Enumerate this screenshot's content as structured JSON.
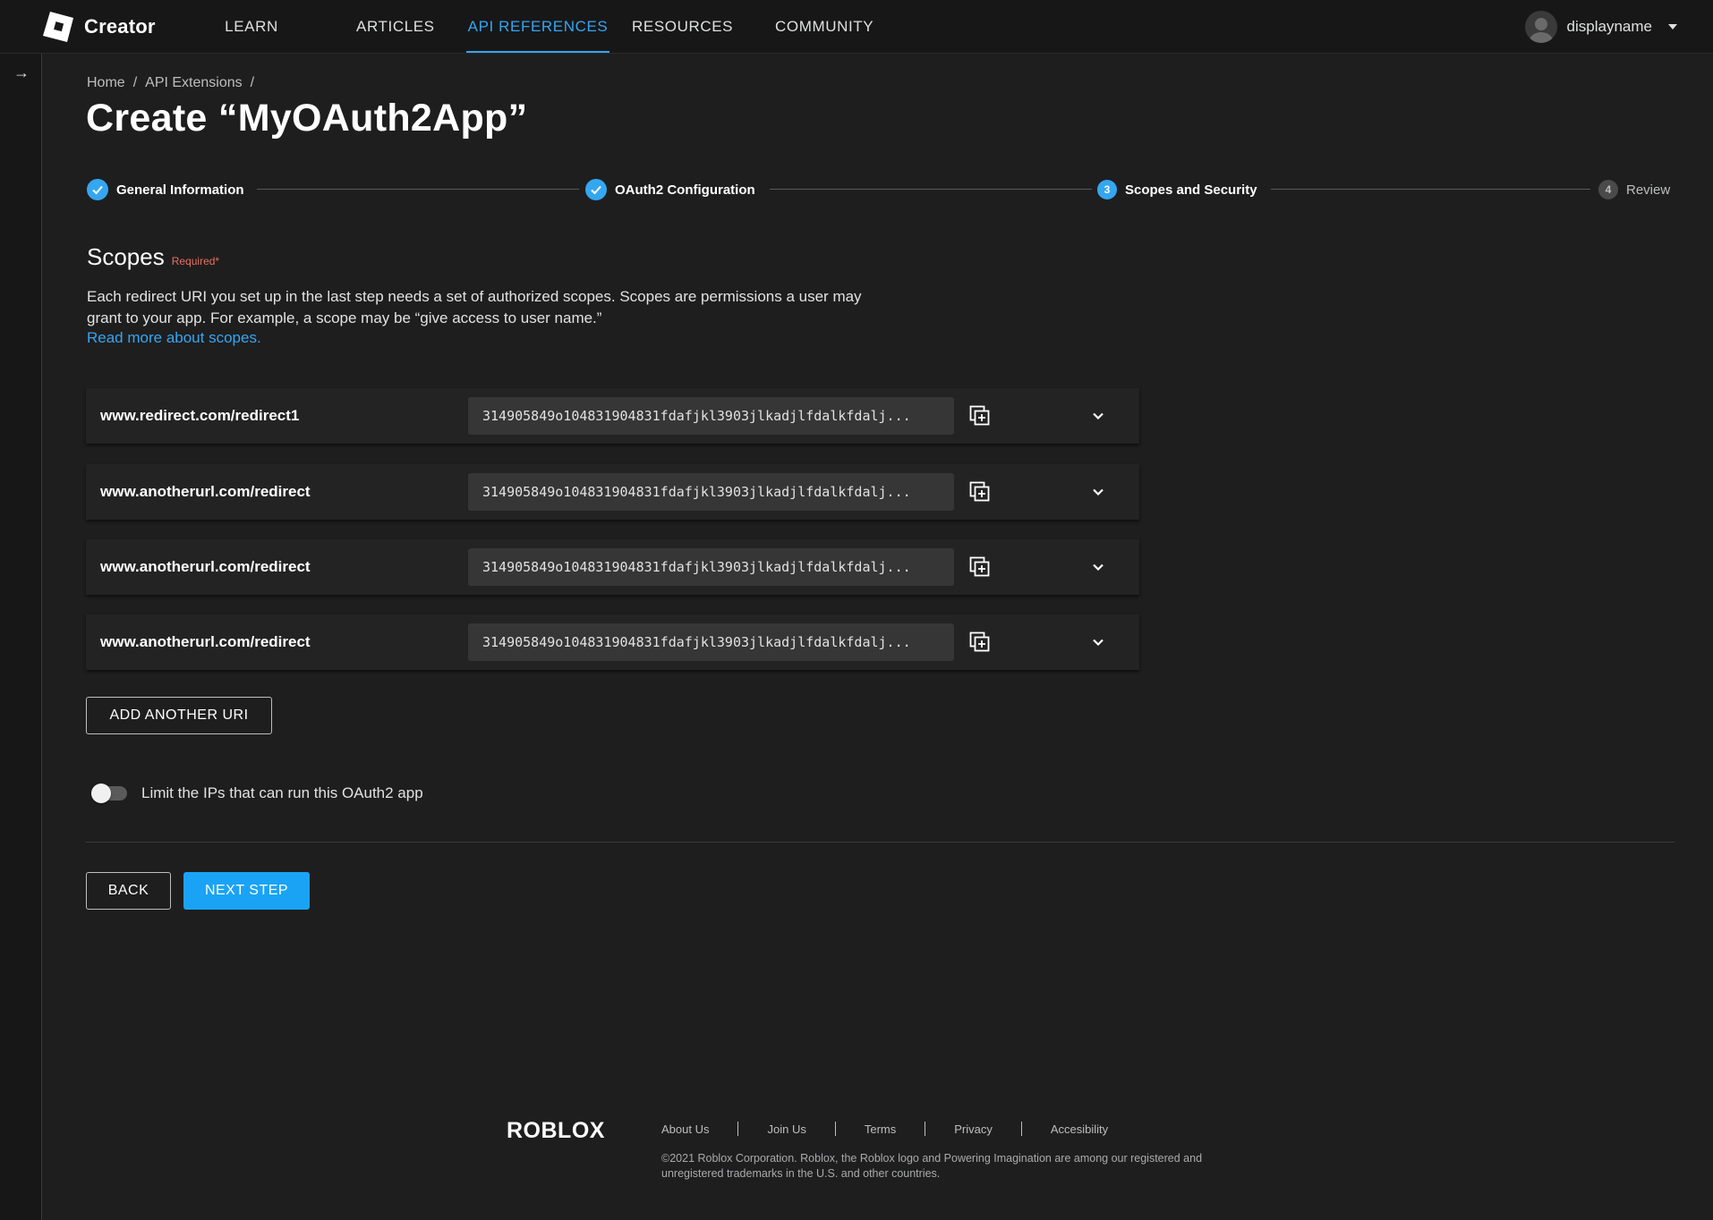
{
  "nav": {
    "brand": "Creator",
    "links": [
      "LEARN",
      "ARTICLES",
      "API REFERENCES",
      "RESOURCES",
      "COMMUNITY"
    ],
    "active_link": "API REFERENCES",
    "username": "displayname"
  },
  "breadcrumb": {
    "items": [
      "Home",
      "API Extensions"
    ],
    "separator": "/"
  },
  "page_title": "Create “MyOAuth2App”",
  "stepper": {
    "steps": [
      {
        "label": "General Information",
        "status": "complete",
        "number": "1"
      },
      {
        "label": "OAuth2 Configuration",
        "status": "complete",
        "number": "2"
      },
      {
        "label": "Scopes and Security",
        "status": "current",
        "number": "3"
      },
      {
        "label": "Review",
        "status": "pending",
        "number": "4"
      }
    ]
  },
  "scopes": {
    "title": "Scopes",
    "required_label": "Required*",
    "description": "Each redirect URI you set up in the last step needs a set of authorized scopes. Scopes are permissions a user may grant to your app. For example, a scope may be “give access to user name.”",
    "read_more": "Read more about scopes.",
    "uris": [
      {
        "uri": "www.redirect.com/redirect1",
        "secret": "314905849o104831904831fdafjkl3903jlkadjlfdalkfdalj..."
      },
      {
        "uri": "www.anotherurl.com/redirect",
        "secret": "314905849o104831904831fdafjkl3903jlkadjlfdalkfdalj..."
      },
      {
        "uri": "www.anotherurl.com/redirect",
        "secret": "314905849o104831904831fdafjkl3903jlkadjlfdalkfdalj..."
      },
      {
        "uri": "www.anotherurl.com/redirect",
        "secret": "314905849o104831904831fdafjkl3903jlkadjlfdalkfdalj..."
      }
    ],
    "add_uri_label": "ADD ANOTHER URI"
  },
  "ip_limit": {
    "label": "Limit the IPs that can run this OAuth2 app",
    "enabled": false
  },
  "actions": {
    "back_label": "BACK",
    "next_label": "NEXT STEP"
  },
  "footer": {
    "logo_text": "ROBLOX",
    "links": [
      "About Us",
      "Join Us",
      "Terms",
      "Privacy",
      "Accesibility"
    ],
    "copyright": "©2021 Roblox Corporation. Roblox, the Roblox logo and Powering Imagination are among our registered and unregistered trademarks in the U.S. and other countries."
  },
  "colors": {
    "accent": "#35a6f0",
    "primary_button": "#1aa3f5",
    "required": "#e96f61",
    "background": "#1e1e1f"
  },
  "icons": {
    "brand": "roblox-creator-logo-icon",
    "collapse_rail": "arrow-right-icon",
    "step_complete": "checkmark-icon",
    "copy": "copy-add-icon",
    "expand": "chevron-down-icon",
    "user_menu": "caret-down-icon"
  }
}
